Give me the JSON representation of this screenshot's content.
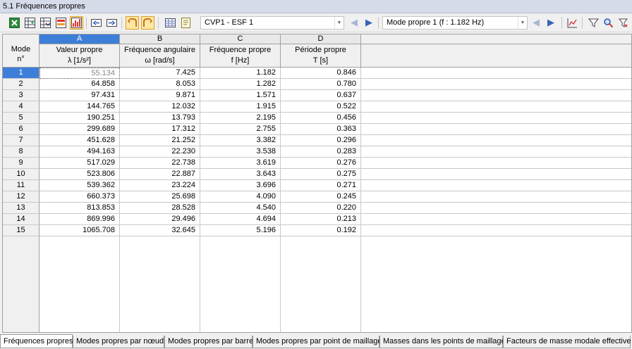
{
  "window": {
    "title": "5.1 Fréquences propres"
  },
  "toolbar": {
    "icons": [
      "excel-export-icon",
      "table-options-icon",
      "filter-table-icon",
      "color-bars-icon",
      "relative-scale-icon",
      "move-left-icon",
      "move-right-icon",
      "undo-icon",
      "redo-icon",
      "table-view-icon",
      "report-icon",
      "chart-icon",
      "filter-icon",
      "search-icon",
      "help-icon"
    ],
    "loadcase_combo": "CVP1 - ESF 1",
    "mode_combo": "Mode propre 1 (f : 1.182 Hz)"
  },
  "table": {
    "mode_header": [
      "Mode",
      "n°"
    ],
    "columns": [
      {
        "letter": "A",
        "name": "Valeur propre",
        "unit": "λ [1/s²]"
      },
      {
        "letter": "B",
        "name": "Fréquence angulaire",
        "unit": "ω [rad/s]"
      },
      {
        "letter": "C",
        "name": "Fréquence propre",
        "unit": "f [Hz]"
      },
      {
        "letter": "D",
        "name": "Période propre",
        "unit": "T [s]"
      }
    ],
    "rows": [
      [
        "1",
        "55.134",
        "7.425",
        "1.182",
        "0.846"
      ],
      [
        "2",
        "64.858",
        "8.053",
        "1.282",
        "0.780"
      ],
      [
        "3",
        "97.431",
        "9.871",
        "1.571",
        "0.637"
      ],
      [
        "4",
        "144.765",
        "12.032",
        "1.915",
        "0.522"
      ],
      [
        "5",
        "190.251",
        "13.793",
        "2.195",
        "0.456"
      ],
      [
        "6",
        "299.689",
        "17.312",
        "2.755",
        "0.363"
      ],
      [
        "7",
        "451.628",
        "21.252",
        "3.382",
        "0.296"
      ],
      [
        "8",
        "494.163",
        "22.230",
        "3.538",
        "0.283"
      ],
      [
        "9",
        "517.029",
        "22.738",
        "3.619",
        "0.276"
      ],
      [
        "10",
        "523.806",
        "22.887",
        "3.643",
        "0.275"
      ],
      [
        "11",
        "539.362",
        "23.224",
        "3.696",
        "0.271"
      ],
      [
        "12",
        "660.373",
        "25.698",
        "4.090",
        "0.245"
      ],
      [
        "13",
        "813.853",
        "28.528",
        "4.540",
        "0.220"
      ],
      [
        "14",
        "869.996",
        "29.496",
        "4.694",
        "0.213"
      ],
      [
        "15",
        "1065.708",
        "32.645",
        "5.196",
        "0.192"
      ]
    ]
  },
  "tabs": [
    "Fréquences propres",
    "Modes propres par nœud",
    "Modes propres par barre",
    "Modes propres par point de maillage",
    "Masses dans les points de maillage",
    "Facteurs de masse modale effective"
  ],
  "colors": {
    "selection": "#3d7fd8",
    "accent_arrow": "#3a63b8",
    "active_button": "#ffe7a6"
  }
}
